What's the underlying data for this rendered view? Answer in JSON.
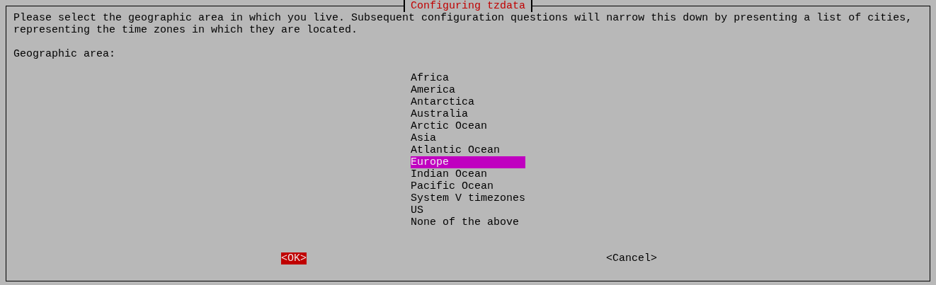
{
  "dialog": {
    "title": "Configuring tzdata",
    "description": "Please select the geographic area in which you live. Subsequent configuration questions will narrow this down by presenting a list of cities, representing the time zones in which they are located.",
    "prompt": "Geographic area:",
    "items": [
      {
        "label": "Africa",
        "selected": false
      },
      {
        "label": "America",
        "selected": false
      },
      {
        "label": "Antarctica",
        "selected": false
      },
      {
        "label": "Australia",
        "selected": false
      },
      {
        "label": "Arctic Ocean",
        "selected": false
      },
      {
        "label": "Asia",
        "selected": false
      },
      {
        "label": "Atlantic Ocean",
        "selected": false
      },
      {
        "label": "Europe",
        "selected": true
      },
      {
        "label": "Indian Ocean",
        "selected": false
      },
      {
        "label": "Pacific Ocean",
        "selected": false
      },
      {
        "label": "System V timezones",
        "selected": false
      },
      {
        "label": "US",
        "selected": false
      },
      {
        "label": "None of the above",
        "selected": false
      }
    ],
    "buttons": [
      {
        "label": "<OK>",
        "selected": true
      },
      {
        "label": "<Cancel>",
        "selected": false
      }
    ]
  }
}
